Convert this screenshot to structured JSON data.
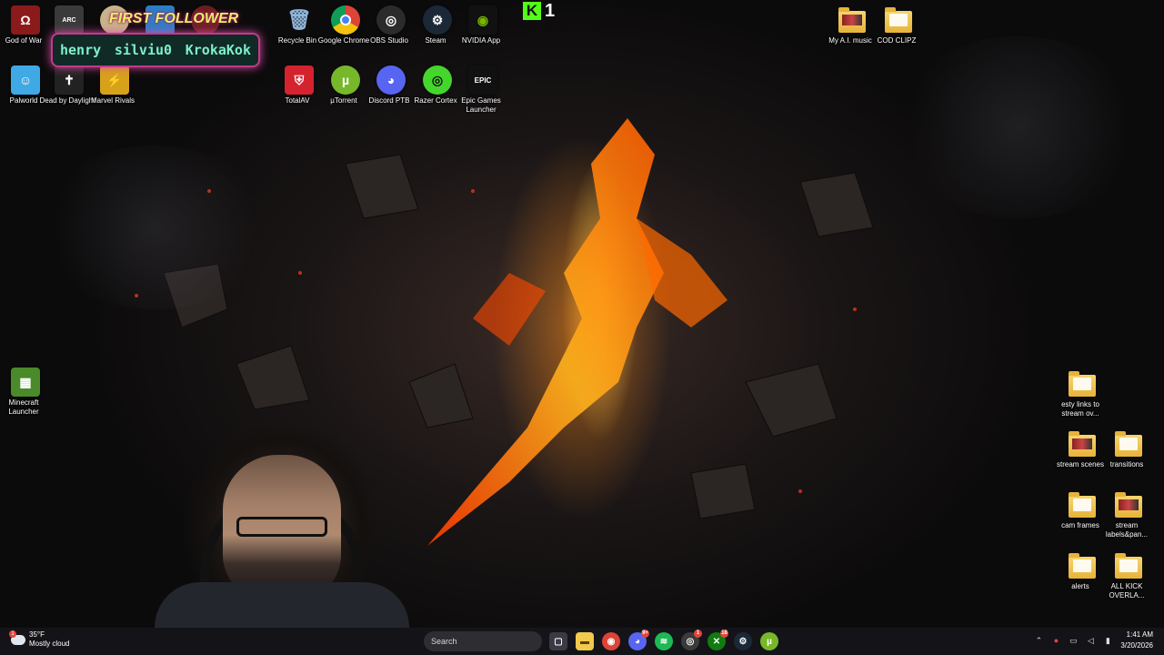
{
  "desktop": {
    "icons_left": [
      {
        "label": "God of War",
        "icon": "god-of-war-icon",
        "color": "#8b1a1a"
      },
      {
        "label": "",
        "icon": "arc-raiders-icon",
        "color": "#3a3a3a"
      },
      {
        "label": "",
        "icon": "game-icon-1",
        "color": "#c8b48a"
      },
      {
        "label": "",
        "icon": "game-icon-2",
        "color": "#2a7ec8"
      },
      {
        "label": "",
        "icon": "game-icon-3",
        "color": "#6a1e1e"
      },
      {
        "label": "Palworld",
        "icon": "palworld-icon",
        "color": "#3fa9e6"
      },
      {
        "label": "Dead by Daylight",
        "icon": "dead-by-daylight-icon",
        "color": "#222222"
      },
      {
        "label": "Marvel Rivals",
        "icon": "marvel-rivals-icon",
        "color": "#d6a21a"
      },
      {
        "label": "Minecraft Launcher",
        "icon": "minecraft-icon",
        "color": "#4a8a2a"
      }
    ],
    "icons_top": [
      {
        "label": "Recycle Bin",
        "icon": "recycle-bin-icon",
        "color": "#8fb6d9"
      },
      {
        "label": "Google Chrome",
        "icon": "chrome-icon",
        "color": "#db4437"
      },
      {
        "label": "OBS Studio",
        "icon": "obs-icon",
        "color": "#2b2b2b"
      },
      {
        "label": "Steam",
        "icon": "steam-icon",
        "color": "#1b2838"
      },
      {
        "label": "NVIDIA App",
        "icon": "nvidia-icon",
        "color": "#76b900"
      },
      {
        "label": "TotalAV",
        "icon": "totalav-icon",
        "color": "#d4232f"
      },
      {
        "label": "µTorrent",
        "icon": "utorrent-icon",
        "color": "#76b82a"
      },
      {
        "label": "Discord PTB",
        "icon": "discord-icon",
        "color": "#5865f2"
      },
      {
        "label": "Razer Cortex",
        "icon": "razer-cortex-icon",
        "color": "#44d62c"
      },
      {
        "label": "Epic Games Launcher",
        "icon": "epic-games-icon",
        "color": "#111111"
      }
    ],
    "folders_top_right": [
      {
        "label": "My A.I. music",
        "icon": "folder-icon"
      },
      {
        "label": "COD CLIPZ",
        "icon": "folder-icon"
      }
    ],
    "folders_right": [
      {
        "label": "esty links to stream ov...",
        "icon": "folder-icon"
      },
      {
        "label": "stream scenes",
        "icon": "folder-icon"
      },
      {
        "label": "transitions",
        "icon": "folder-icon"
      },
      {
        "label": "cam frames",
        "icon": "folder-icon"
      },
      {
        "label": "stream labels&pan...",
        "icon": "folder-icon"
      },
      {
        "label": "alerts",
        "icon": "folder-icon"
      },
      {
        "label": "ALL KICK OVERLA...",
        "icon": "folder-icon"
      }
    ]
  },
  "overlay": {
    "title": "FIRST FOLLOWER",
    "names": [
      "henry",
      "silviu0",
      "KrokaKok"
    ],
    "kick_letter": "K",
    "kick_count": "1"
  },
  "taskbar": {
    "weather_temp": "35°F",
    "weather_desc": "Mostly cloud",
    "weather_badge": "1",
    "search_placeholder": "Search",
    "apps": [
      {
        "name": "task-view",
        "glyph": "▢",
        "color": "#3a3a44",
        "badge": ""
      },
      {
        "name": "file-explorer",
        "glyph": "▬",
        "color": "#f2c94c",
        "badge": ""
      },
      {
        "name": "chrome",
        "glyph": "◉",
        "color": "#db4437",
        "badge": ""
      },
      {
        "name": "discord",
        "glyph": "◕",
        "color": "#5865f2",
        "badge": "9+"
      },
      {
        "name": "spotify",
        "glyph": "≋",
        "color": "#1db954",
        "badge": ""
      },
      {
        "name": "obs",
        "glyph": "◎",
        "color": "#3b3b3b",
        "badge": "1"
      },
      {
        "name": "xbox",
        "glyph": "✕",
        "color": "#107c10",
        "badge": "18"
      },
      {
        "name": "steam",
        "glyph": "⚙",
        "color": "#1b2838",
        "badge": ""
      },
      {
        "name": "utorrent",
        "glyph": "µ",
        "color": "#76b82a",
        "badge": ""
      }
    ],
    "time": "1:41 AM",
    "date": "3/20/2026"
  }
}
